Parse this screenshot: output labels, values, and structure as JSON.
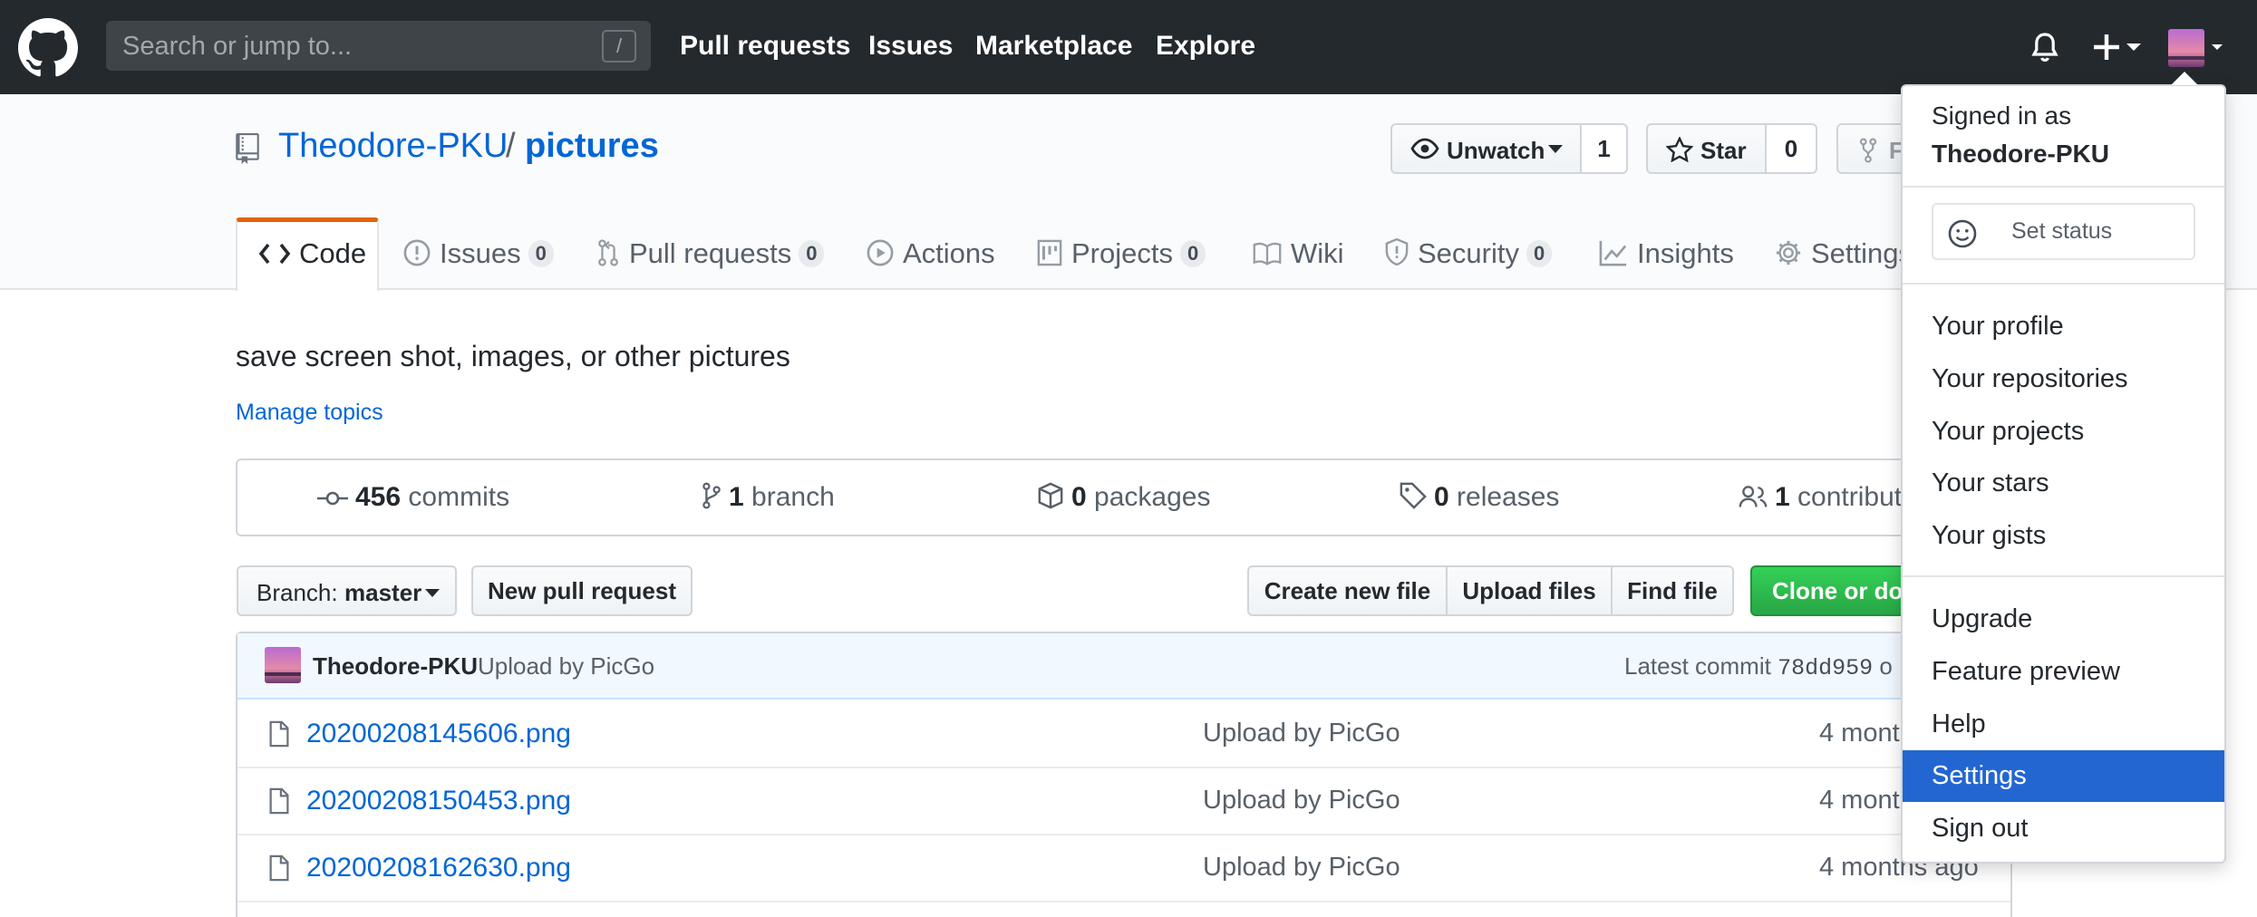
{
  "header": {
    "search_placeholder": "Search or jump to...",
    "search_shortcut": "/",
    "nav": [
      "Pull requests",
      "Issues",
      "Marketplace",
      "Explore"
    ]
  },
  "repo": {
    "owner": "Theodore-PKU",
    "separator": "/",
    "name": "pictures",
    "watch_label": "Unwatch",
    "watch_count": "1",
    "star_label": "Star",
    "star_count": "0",
    "fork_label": "F"
  },
  "tabs": [
    {
      "label": "Code"
    },
    {
      "label": "Issues",
      "count": "0"
    },
    {
      "label": "Pull requests",
      "count": "0"
    },
    {
      "label": "Actions"
    },
    {
      "label": "Projects",
      "count": "0"
    },
    {
      "label": "Wiki"
    },
    {
      "label": "Security",
      "count": "0"
    },
    {
      "label": "Insights"
    },
    {
      "label": "Settings"
    }
  ],
  "description": "save screen shot, images, or other pictures",
  "manage_topics": "Manage topics",
  "summary": {
    "commits_num": "456",
    "commits_label": "commits",
    "branch_num": "1",
    "branch_label": "branch",
    "packages_num": "0",
    "packages_label": "packages",
    "releases_num": "0",
    "releases_label": "releases",
    "contributors_num": "1",
    "contributors_label": "contribut"
  },
  "file_nav": {
    "branch_prefix": "Branch:",
    "branch_name": "master",
    "new_pr": "New pull request",
    "create_file": "Create new file",
    "upload_files": "Upload files",
    "find_file": "Find file",
    "clone": "Clone or dow"
  },
  "latest_commit": {
    "author": "Theodore-PKU",
    "message": "Upload by PicGo",
    "prefix": "Latest commit",
    "sha": "78dd959",
    "suffix": "o"
  },
  "files": [
    {
      "name": "20200208145606.png",
      "message": "Upload by PicGo",
      "age": "4 mont"
    },
    {
      "name": "20200208150453.png",
      "message": "Upload by PicGo",
      "age": "4 mont"
    },
    {
      "name": "20200208162630.png",
      "message": "Upload by PicGo",
      "age": "4 months ago"
    }
  ],
  "user_menu": {
    "signed_in_as": "Signed in as",
    "username": "Theodore-PKU",
    "set_status": "Set status",
    "items_1": [
      "Your profile",
      "Your repositories",
      "Your projects",
      "Your stars",
      "Your gists"
    ],
    "items_2": [
      "Upgrade",
      "Feature preview",
      "Help",
      "Settings",
      "Sign out"
    ],
    "active_item": "Settings"
  },
  "colors": {
    "header_bg": "#24292e",
    "link": "#0366d6",
    "active_tab_accent": "#e36209",
    "clone_button": "#28a745",
    "menu_highlight": "#2366d1"
  }
}
